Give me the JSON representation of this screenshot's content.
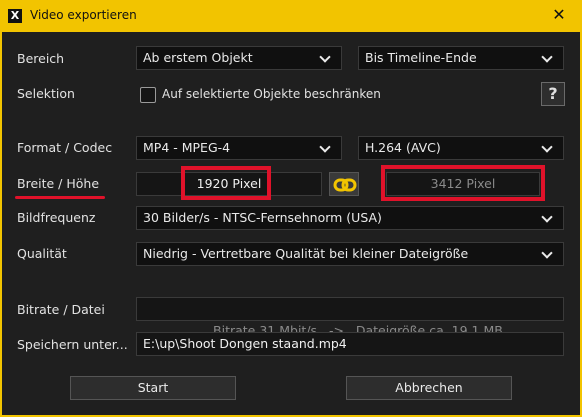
{
  "window": {
    "title": "Video exportieren",
    "app_icon": "X",
    "close_glyph": "✕"
  },
  "labels": {
    "bereich": "Bereich",
    "selektion": "Selektion",
    "format": "Format / Codec",
    "breite": "Breite / Höhe",
    "bildfrequenz": "Bildfrequenz",
    "qualitaet": "Qualität",
    "bitrate": "Bitrate / Datei",
    "speichern": "Speichern unter..."
  },
  "bereich": {
    "start": "Ab erstem Objekt",
    "end": "Bis Timeline-Ende"
  },
  "selektion": {
    "checkbox_label": "Auf selektierte Objekte beschränken",
    "checked": false,
    "help_label": "?"
  },
  "format": {
    "container": "MP4 - MPEG-4",
    "codec": "H.264 (AVC)"
  },
  "size": {
    "width": "1920 Pixel",
    "height": "3412 Pixel",
    "link_icon": "link-icon"
  },
  "bildfrequenz": {
    "value": "30 Bilder/s - NTSC-Fernsehnorm (USA)"
  },
  "qualitaet": {
    "value": "Niedrig - Vertretbare Qualität bei kleiner Dateigröße"
  },
  "bitrate": {
    "text": "Bitrate 31 Mbit/s   ->   Dateigröße ca. 19.1 MB"
  },
  "speichern": {
    "path": "E:\\up\\Shoot Dongen staand.mp4"
  },
  "buttons": {
    "start": "Start",
    "cancel": "Abbrechen"
  },
  "colors": {
    "accent_yellow": "#f2c400",
    "highlight_red": "#e0122a",
    "link_icon_yellow": "#f2c400"
  }
}
